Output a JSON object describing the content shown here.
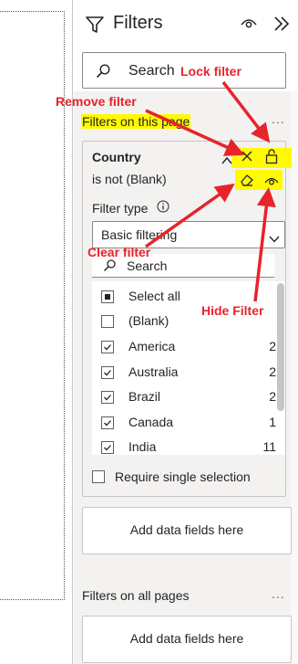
{
  "header": {
    "title": "Filters",
    "search_placeholder": "Search"
  },
  "filters_on_this_page": {
    "label": "Filters on this page",
    "more": "..."
  },
  "filter_card": {
    "title": "Country",
    "subtitle": "is not (Blank)",
    "filter_type_label": "Filter type",
    "filter_type_value": "Basic filtering",
    "search_placeholder": "Search",
    "items": [
      {
        "label": "Select all",
        "count": "",
        "state": "partial"
      },
      {
        "label": "(Blank)",
        "count": "",
        "state": "unchecked"
      },
      {
        "label": "America",
        "count": "2",
        "state": "checked"
      },
      {
        "label": "Australia",
        "count": "2",
        "state": "checked"
      },
      {
        "label": "Brazil",
        "count": "2",
        "state": "checked"
      },
      {
        "label": "Canada",
        "count": "1",
        "state": "checked"
      },
      {
        "label": "India",
        "count": "11",
        "state": "checked"
      }
    ],
    "require_single_selection": "Require single selection"
  },
  "drop_zone": {
    "page_label": "Add data fields here",
    "all_pages_label": "Add data fields here"
  },
  "filters_on_all_pages": {
    "label": "Filters on all pages",
    "more": "..."
  },
  "annotations": {
    "remove_filter": "Remove filter",
    "lock_filter": "Lock filter",
    "clear_filter": "Clear filter",
    "hide_filter": "Hide Filter"
  },
  "colors": {
    "annotation_red": "#e8232b",
    "highlight_yellow": "#fffa00",
    "panel_bg": "#f3f2f1"
  }
}
